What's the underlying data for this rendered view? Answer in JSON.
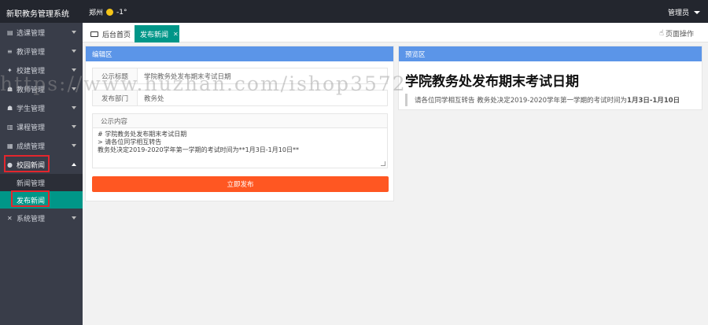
{
  "app": {
    "title": "新职教务管理系统"
  },
  "weather": {
    "city": "郑州",
    "temp": "-1°"
  },
  "user": {
    "name": "管理员"
  },
  "sidebar": {
    "items": [
      {
        "icon": "document-icon",
        "glyph": "▤",
        "label": "选课管理"
      },
      {
        "icon": "list-icon",
        "glyph": "≡",
        "label": "教评管理"
      },
      {
        "icon": "graduation-cap-icon",
        "glyph": "✦",
        "label": "校建管理"
      },
      {
        "icon": "users-icon",
        "glyph": "☗",
        "label": "教师管理"
      },
      {
        "icon": "user-icon",
        "glyph": "☗",
        "label": "学生管理"
      },
      {
        "icon": "book-icon",
        "glyph": "▥",
        "label": "课程管理"
      },
      {
        "icon": "chart-icon",
        "glyph": "▦",
        "label": "成绩管理"
      },
      {
        "icon": "chat-icon",
        "glyph": "●",
        "label": "校园新闻"
      },
      {
        "icon": "settings-icon",
        "glyph": "✕",
        "label": "系统管理"
      }
    ],
    "sub_items": [
      {
        "label": "新闻管理"
      },
      {
        "label": "发布新闻"
      }
    ]
  },
  "tabs": {
    "home": "后台首页",
    "active": "发布新闻",
    "page_ops": "页面操作"
  },
  "editor": {
    "header": "编辑区",
    "title_label": "公示标题",
    "title_value": "学院教务处发布期末考试日期",
    "dept_label": "发布部门",
    "dept_value": "教务处",
    "content_label": "公示内容",
    "content_lines": [
      "# 学院教务处发布期末考试日期",
      "> 请各位同学相互转告",
      "教务处决定2019-2020学年第一学期的考试时间为**1月3日-1月10日**"
    ],
    "publish_button": "立即发布"
  },
  "preview": {
    "header": "预览区",
    "title": "学院教务处发布期末考试日期",
    "quote_prefix": "请各位同学相互转告 教务处决定2019-2020学年第一学期的考试时间为",
    "quote_bold": "1月3日-1月10日"
  },
  "watermark": "https://www.huzhan.com/ishop3572",
  "colors": {
    "sidebar": "#393d49",
    "topbar": "#23262e",
    "accent": "#009688",
    "publish": "#ff5722",
    "panel_head": "#5b95e8"
  }
}
